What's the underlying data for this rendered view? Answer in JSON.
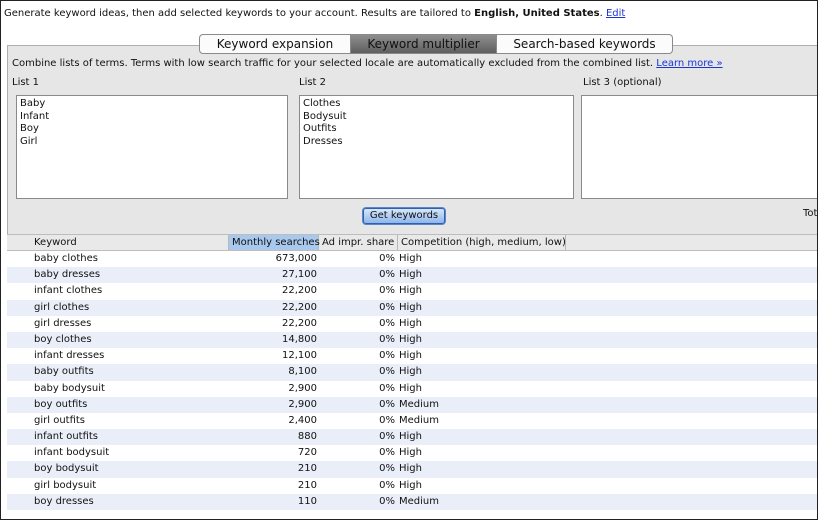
{
  "intro": {
    "text": "Generate keyword ideas, then add selected keywords to your account. Results are tailored to ",
    "locale": "English, United States",
    "period": ".",
    "edit_link": "Edit"
  },
  "tabs": [
    {
      "label": "Keyword expansion",
      "selected": false
    },
    {
      "label": "Keyword multiplier",
      "selected": true
    },
    {
      "label": "Search-based keywords",
      "selected": false
    }
  ],
  "panel": {
    "description": "Combine lists of terms. Terms with low search traffic for your selected locale are automatically excluded from the combined list.",
    "learn_more": "Learn more »",
    "list1_label": "List 1",
    "list2_label": "List 2",
    "list3_label": "List 3 (optional)",
    "list1_values": [
      "Baby",
      "Infant",
      "Boy",
      "Girl"
    ],
    "list2_values": [
      "Clothes",
      "Bodysuit",
      "Outfits",
      "Dresses"
    ],
    "list3_values": [],
    "get_keywords_button": "Get keywords",
    "total_label": "Tot"
  },
  "table": {
    "columns": [
      "Keyword",
      "Monthly searches",
      "Ad impr. share",
      "Competition (high, medium, low)"
    ],
    "sorted_column": "Monthly searches",
    "rows": [
      {
        "keyword": "baby clothes",
        "monthly": "673,000",
        "ad_share": "0%",
        "competition": "High"
      },
      {
        "keyword": "baby dresses",
        "monthly": "27,100",
        "ad_share": "0%",
        "competition": "High"
      },
      {
        "keyword": "infant clothes",
        "monthly": "22,200",
        "ad_share": "0%",
        "competition": "High"
      },
      {
        "keyword": "girl clothes",
        "monthly": "22,200",
        "ad_share": "0%",
        "competition": "High"
      },
      {
        "keyword": "girl dresses",
        "monthly": "22,200",
        "ad_share": "0%",
        "competition": "High"
      },
      {
        "keyword": "boy clothes",
        "monthly": "14,800",
        "ad_share": "0%",
        "competition": "High"
      },
      {
        "keyword": "infant dresses",
        "monthly": "12,100",
        "ad_share": "0%",
        "competition": "High"
      },
      {
        "keyword": "baby outfits",
        "monthly": "8,100",
        "ad_share": "0%",
        "competition": "High"
      },
      {
        "keyword": "baby bodysuit",
        "monthly": "2,900",
        "ad_share": "0%",
        "competition": "High"
      },
      {
        "keyword": "boy outfits",
        "monthly": "2,900",
        "ad_share": "0%",
        "competition": "Medium"
      },
      {
        "keyword": "girl outfits",
        "monthly": "2,400",
        "ad_share": "0%",
        "competition": "Medium"
      },
      {
        "keyword": "infant outfits",
        "monthly": "880",
        "ad_share": "0%",
        "competition": "High"
      },
      {
        "keyword": "infant bodysuit",
        "monthly": "720",
        "ad_share": "0%",
        "competition": "High"
      },
      {
        "keyword": "boy bodysuit",
        "monthly": "210",
        "ad_share": "0%",
        "competition": "High"
      },
      {
        "keyword": "girl bodysuit",
        "monthly": "210",
        "ad_share": "0%",
        "competition": "High"
      },
      {
        "keyword": "boy dresses",
        "monthly": "110",
        "ad_share": "0%",
        "competition": "Medium"
      }
    ]
  },
  "colors": {
    "link": "#1a35d6",
    "selected_tab": "#6f6f6f",
    "sorted_header": "#a8c8ee",
    "row_stripe": "#e9eef8",
    "panel_bg": "#e6e6e6"
  }
}
